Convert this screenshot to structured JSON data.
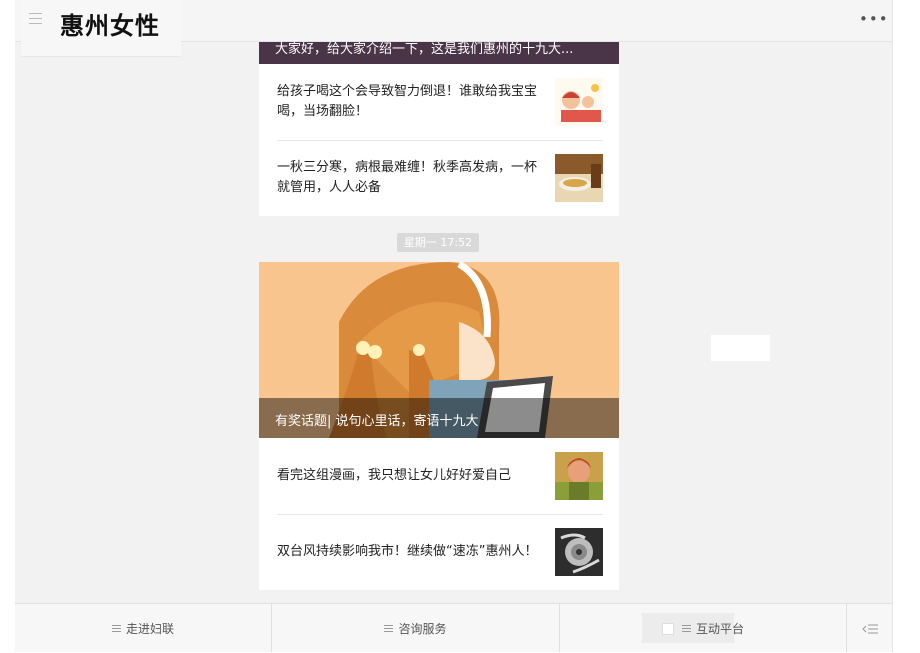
{
  "header": {
    "title": "惠州女性",
    "more_label": "•••"
  },
  "feed": {
    "top_banner_caption": "大家好，给大家介绍一下，这是我们惠州的十九大...",
    "top_items": [
      {
        "text": "给孩子喝这个会导致智力倒退！谁敢给我宝宝喝，当场翻脸！",
        "thumb": "cartoon-kids-thumbnail"
      },
      {
        "text": "一秋三分寒，病根最难缠！秋季高发病，一杯就管用，人人必备",
        "thumb": "tea-cup-thumbnail"
      }
    ],
    "timestamp": "星期一 17:52",
    "main_caption": "有奖话题| 说句心里话，寄语十九大",
    "main_items": [
      {
        "text": "看完这组漫画，我只想让女儿好好爱自己",
        "thumb": "girl-portrait-thumbnail"
      },
      {
        "text": "双台风持续影响我市！继续做“速冻”惠州人！",
        "thumb": "typhoon-satellite-thumbnail"
      }
    ]
  },
  "bottom_nav": {
    "items": [
      "走进妇联",
      "咨询服务",
      "互动平台"
    ],
    "keyboard_icon": "keyboard-toggle-icon"
  },
  "colors": {
    "background": "#f2f2f2",
    "card": "#ffffff",
    "timestamp_bg": "#d9d9d9"
  }
}
